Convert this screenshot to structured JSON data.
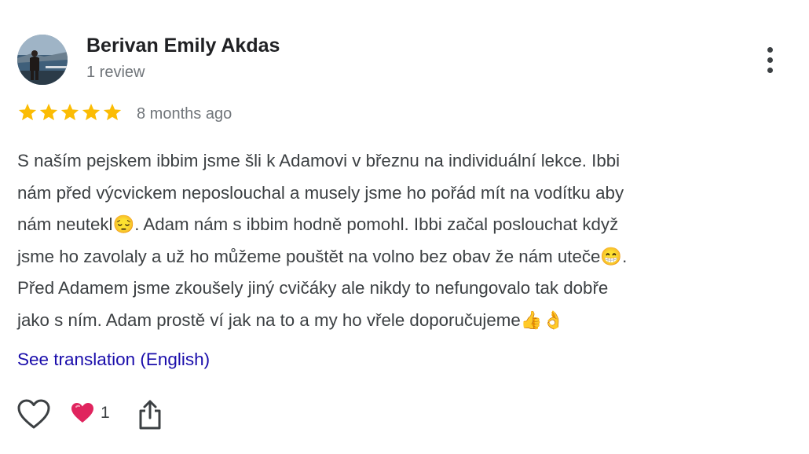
{
  "author": {
    "name": "Berivan Emily Akdas",
    "review_count": "1 review",
    "avatar_icon": "profile-photo"
  },
  "review": {
    "rating": 5,
    "rating_max": 5,
    "date": "8 months ago",
    "text": "S naším pejskem ibbim jsme šli k Adamovi v březnu na individuální lekce. Ibbi\nnám před výcvickem neposlouchal a musely jsme ho pořád mít na vodítku aby\nnám neutekl😔. Adam nám s ibbim hodně pomohl. Ibbi začal poslouchat když\njsme ho zavolaly a už ho můžeme pouštět na volno bez obav že nám uteče😁.\nPřed Adamem jsme zkoušely jiný cvičáky ale nikdy to nefungovalo tak dobře\njako s ním. Adam prostě ví jak na to a my ho vřele doporučujeme👍👌",
    "translate_link": "See translation (English)"
  },
  "actions": {
    "like_icon": "heart-outline-icon",
    "reaction_icon": "red-heart-icon",
    "reaction_count": "1",
    "share_icon": "share-icon",
    "more_icon": "more-vertical-icon"
  },
  "colors": {
    "star": "#fbbc04",
    "link": "#1a0dab",
    "heart": "#e0245e",
    "name": "#202124",
    "meta": "#70757a",
    "body": "#3c4043"
  }
}
